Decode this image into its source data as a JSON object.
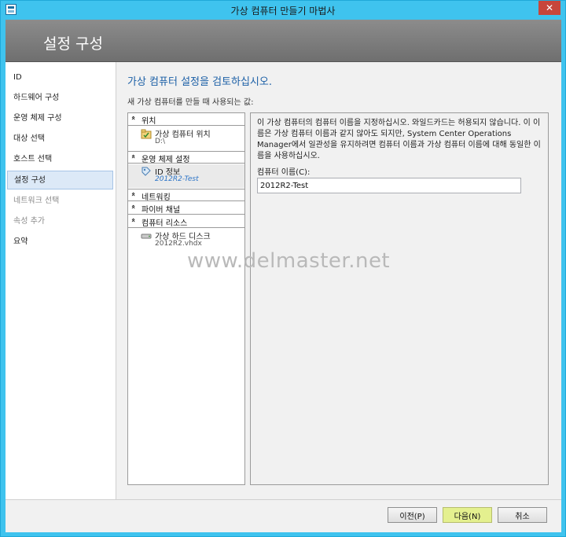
{
  "window": {
    "title": "가상 컴퓨터 만들기 마법사",
    "close_glyph": "✕"
  },
  "banner": {
    "title": "설정 구성"
  },
  "sidebar": {
    "items": [
      {
        "label": "ID",
        "state": "normal"
      },
      {
        "label": "하드웨어 구성",
        "state": "normal"
      },
      {
        "label": "운영 체제 구성",
        "state": "normal"
      },
      {
        "label": "대상 선택",
        "state": "normal"
      },
      {
        "label": "호스트 선택",
        "state": "normal"
      },
      {
        "label": "설정 구성",
        "state": "active"
      },
      {
        "label": "네트워크 선택",
        "state": "disabled"
      },
      {
        "label": "속성 추가",
        "state": "disabled"
      },
      {
        "label": "요약",
        "state": "normal"
      }
    ]
  },
  "main": {
    "heading": "가상 컴퓨터 설정을 검토하십시오.",
    "subheading": "새 가상 컴퓨터를 만들 때 사용되는 값:"
  },
  "tree": {
    "chevron_glyph": "«",
    "location_header": "위치",
    "location_item_name": "가상 컴퓨터 위치",
    "location_item_value": "D:\\",
    "os_header": "운영 체제 설정",
    "id_item_name": "ID 정보",
    "id_item_value": "2012R2-Test",
    "network_header": "네트워킹",
    "fibre_header": "파이버 채널",
    "resources_header": "컴퓨터 리소스",
    "disk_item_name": "가상 하드 디스크",
    "disk_item_value": "2012R2.vhdx"
  },
  "detail": {
    "description": "이 가상 컴퓨터의 컴퓨터 이름을 지정하십시오. 와일드카드는 허용되지 않습니다. 이 이름은 가상 컴퓨터 이름과 같지 않아도 되지만, System Center Operations Manager에서 일관성을 유지하려면 컴퓨터 이름과 가상 컴퓨터 이름에 대해 동일한 이름을 사용하십시오.",
    "computer_name_label": "컴퓨터 이름(C):",
    "computer_name_value": "2012R2-Test"
  },
  "watermark": "www.delmaster.net",
  "footer": {
    "back_label": "이전(P)",
    "next_label": "다음(N)",
    "cancel_label": "취소"
  },
  "colors": {
    "titlebar": "#3fc3ee",
    "heading_blue": "#1b5fa6",
    "next_button": "#e4f08f",
    "close_button": "#c7463b"
  }
}
